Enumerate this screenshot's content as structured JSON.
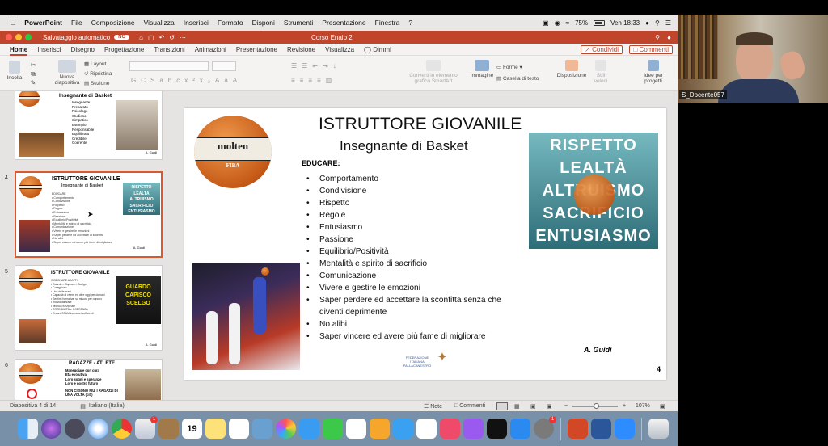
{
  "menubar": {
    "app": "PowerPoint",
    "items": [
      "File",
      "Composizione",
      "Visualizza",
      "Inserisci",
      "Formato",
      "Disponi",
      "Strumenti",
      "Presentazione",
      "Finestra",
      "?"
    ],
    "battery": "75%",
    "clock": "Ven 18:33"
  },
  "titlebar": {
    "autosave": "Salvataggio automatico",
    "toggle": "NO",
    "doc_title": "Corso Enaip 2"
  },
  "tabs": [
    "Home",
    "Inserisci",
    "Disegno",
    "Progettazione",
    "Transizioni",
    "Animazioni",
    "Presentazione",
    "Revisione",
    "Visualizza",
    "Dimmi"
  ],
  "share_label": "Condividi",
  "comments_label": "Commenti",
  "ribbon": {
    "paste": "Incolla",
    "new_slide": "Nuova diapositiva",
    "layout": "Layout",
    "reset": "Ripristina",
    "section": "Sezione",
    "smartart": "Converti in elemento grafico SmartArt",
    "image": "Immagine",
    "shapes": "Forme",
    "textbox": "Casella di testo",
    "arrange": "Disposizione",
    "styles": "Stili veloci",
    "design": "Idee per progetti"
  },
  "thumbs": [
    {
      "num": "",
      "title": "Insegnante di Basket",
      "items": [
        "Insegnante",
        "Preparato",
        "Psicologo",
        "Studioso",
        "Simpatico",
        "Esempio",
        "Responsabile",
        "Equilibrato",
        "Credibile",
        "Coerente"
      ],
      "author": "A. Guidi"
    },
    {
      "num": "4",
      "title": "ISTRUTTORE GIOVANILE",
      "subtitle": "Insegnante di Basket",
      "author": "A. Guidi"
    },
    {
      "num": "5",
      "title": "ISTRUTTORE GIOVANILE",
      "poster": "GUARDO CAPISCO SCELGO",
      "author": "A. Guidi"
    },
    {
      "num": "6",
      "title": "RAGAZZE - ATLETE",
      "items": [
        "Maneggiare con cura",
        "Età evolutiva",
        "Loro sogni e speranze",
        "Loro e nostro futuro"
      ],
      "note": "NON CI SONO PIU' I RAGAZZI DI UNA VOLTA (cit.)"
    }
  ],
  "slide": {
    "title": "ISTRUTTORE GIOVANILE",
    "subtitle": "Insegnante di Basket",
    "educare": "EDUCARE:",
    "bullets": [
      "Comportamento",
      "Condivisione",
      "Rispetto",
      "Regole",
      "Entusiasmo",
      "Passione",
      "Equilibrio/Positività",
      "Mentalità e spirito di sacrificio",
      "Comunicazione",
      "Vivere e gestire le emozioni",
      "Saper perdere ed accettare la sconfitta senza che diventi deprimente",
      "No alibi",
      "Saper vincere ed avere più fame di migliorare"
    ],
    "author": "A. Guidi",
    "number": "4",
    "ball_brand": "molten",
    "ball_sub": "FIBA",
    "poster_words": [
      "RISPETTO",
      "LEALTÀ",
      "ALTRUISMO",
      "SACRIFICIO",
      "ENTUSIASMO"
    ],
    "federation": "FEDERAZIONE ITALIANA PALLACANESTRO",
    "fip": "FIP"
  },
  "statusbar": {
    "slide_info": "Diapositiva 4 di 14",
    "language": "Italiano (Italia)",
    "notes": "Note",
    "comments": "Commenti",
    "zoom": "107%"
  },
  "video": {
    "participant": "S_Docente057"
  },
  "dock": {
    "badges": {
      "mail": "1",
      "settings": "1"
    },
    "calendar_day": "19"
  }
}
